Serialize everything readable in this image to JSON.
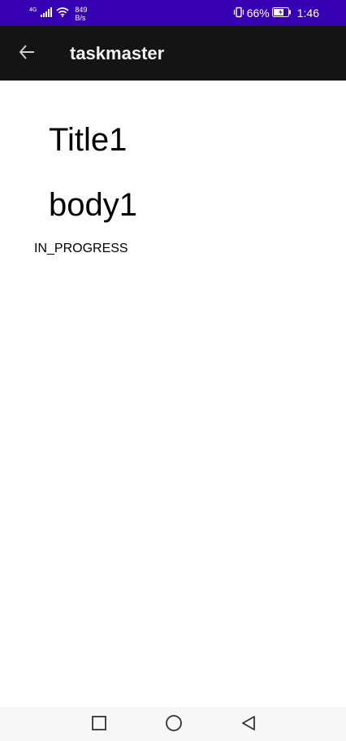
{
  "status_bar": {
    "network_type": "4G",
    "speed_value": "849",
    "speed_unit": "B/s",
    "battery_percent": "66%",
    "time": "1:46",
    "background_color": "#3700b3"
  },
  "app_bar": {
    "title": "taskmaster",
    "back_icon": "arrow-left-icon",
    "background_color": "#141414"
  },
  "task": {
    "title": "Title1",
    "body": "body1",
    "state": "IN_PROGRESS"
  },
  "nav_bar": {
    "recents_icon": "square-icon",
    "home_icon": "circle-icon",
    "back_icon": "triangle-back-icon"
  }
}
